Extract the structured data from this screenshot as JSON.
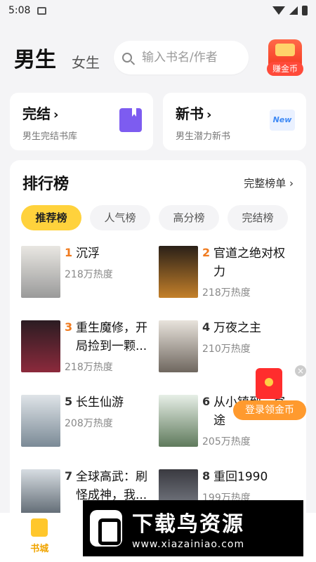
{
  "status_bar": {
    "time": "5:08"
  },
  "header": {
    "tab_male": "男生",
    "tab_female": "女生",
    "search_placeholder": "输入书名/作者",
    "coin_badge": "赚金币"
  },
  "cards": [
    {
      "title": "完结",
      "subtitle": "男生完结书库",
      "icon": "bookmark-icon"
    },
    {
      "title": "新书",
      "subtitle": "男生潜力新书",
      "icon": "new-icon",
      "icon_text": "New"
    }
  ],
  "ranking": {
    "title": "排行榜",
    "view_all": "完整榜单",
    "tabs": [
      "推荐榜",
      "人气榜",
      "高分榜",
      "完结榜"
    ],
    "active_tab": "推荐榜",
    "books": [
      {
        "rank": "1",
        "name": "沉浮",
        "heat": "218万热度",
        "rank_color": "#f07b1f"
      },
      {
        "rank": "2",
        "name": "官道之绝对权力",
        "heat": "218万热度",
        "rank_color": "#f07b1f"
      },
      {
        "rank": "3",
        "name": "重生魔修，开局捡到一颗...",
        "heat": "218万热度",
        "rank_color": "#f07b1f"
      },
      {
        "rank": "4",
        "name": "万夜之主",
        "heat": "210万热度",
        "rank_color": "#333333"
      },
      {
        "rank": "5",
        "name": "长生仙游",
        "heat": "208万热度",
        "rank_color": "#333333"
      },
      {
        "rank": "6",
        "name": "从小镇到一官途",
        "heat": "205万热度",
        "rank_color": "#333333"
      },
      {
        "rank": "7",
        "name": "全球高武：刷怪成神，我...",
        "heat": "",
        "rank_color": "#333333"
      },
      {
        "rank": "8",
        "name": "重回1990",
        "heat": "199万热度",
        "rank_color": "#333333"
      }
    ]
  },
  "red_packet": {
    "label": "登录领金币"
  },
  "bottom_nav": {
    "active": "书城",
    "items": [
      "书城"
    ]
  },
  "watermark": {
    "cn": "下载鸟资源",
    "url": "www.xiazainiao.com"
  },
  "colors": {
    "accent_yellow": "#ffd23c",
    "rank_top": "#f07b1f"
  }
}
